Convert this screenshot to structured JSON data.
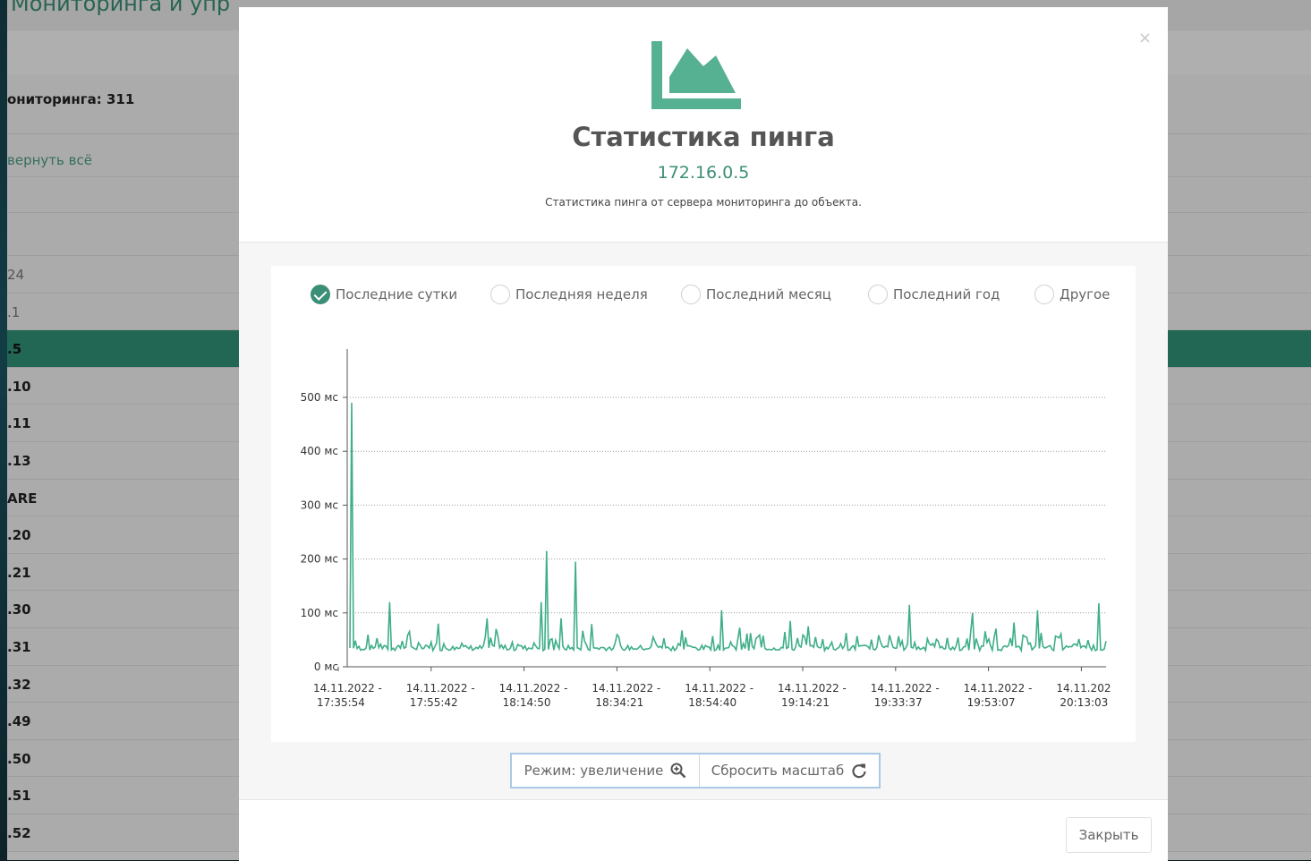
{
  "background": {
    "title": "Мониторинга и упр",
    "monitoring_count": "ониторинга: 311",
    "collapse_link": "вернуть всё",
    "rows": [
      "24",
      ".1",
      ".5",
      ".10",
      ".11",
      ".13",
      "ARE",
      ".20",
      ".21",
      ".30",
      ".31",
      ".32",
      ".49",
      ".50",
      ".51",
      ".52"
    ],
    "active_row_index": 2
  },
  "modal": {
    "icon": "area-chart-icon",
    "title": "Статистика пинга",
    "ip": "172.16.0.5",
    "description": "Статистика пинга от сервера мониторинга до объекта.",
    "close_symbol": "×",
    "periods": [
      {
        "label": "Последние сутки",
        "checked": true
      },
      {
        "label": "Последняя неделя",
        "checked": false
      },
      {
        "label": "Последний месяц",
        "checked": false
      },
      {
        "label": "Последний год",
        "checked": false
      },
      {
        "label": "Другое",
        "checked": false
      }
    ],
    "zoom_mode_label": "Режим: увеличение",
    "reset_zoom_label": "Сбросить масштаб",
    "footer_close_label": "Закрыть"
  },
  "colors": {
    "accent": "#3c8f77",
    "series": "#3fae8a",
    "active_row": "#2f8f73"
  },
  "chart_data": {
    "type": "line",
    "title": "",
    "xlabel": "",
    "ylabel": "",
    "ylim": [
      0,
      500
    ],
    "y_ticks": [
      "0 мс",
      "100 мс",
      "200 мс",
      "300 мс",
      "400 мс",
      "500 мс"
    ],
    "grid": true,
    "x_ticks": [
      [
        "14.11.2022 -",
        "17:35:54"
      ],
      [
        "14.11.2022 -",
        "17:55:42"
      ],
      [
        "14.11.2022 -",
        "18:14:50"
      ],
      [
        "14.11.2022 -",
        "18:34:21"
      ],
      [
        "14.11.2022 -",
        "18:54:40"
      ],
      [
        "14.11.2022 -",
        "19:14:21"
      ],
      [
        "14.11.2022 -",
        "19:33:37"
      ],
      [
        "14.11.2022 -",
        "19:53:07"
      ],
      [
        "14.11.202",
        "20:13:03"
      ]
    ],
    "series": [
      {
        "baseline_ms": 35,
        "points": 420,
        "spikes": [
          {
            "at": 0.003,
            "ms": 490
          },
          {
            "at": 0.052,
            "ms": 120
          },
          {
            "at": 0.117,
            "ms": 80
          },
          {
            "at": 0.181,
            "ms": 90
          },
          {
            "at": 0.252,
            "ms": 120
          },
          {
            "at": 0.259,
            "ms": 215
          },
          {
            "at": 0.28,
            "ms": 90
          },
          {
            "at": 0.299,
            "ms": 195
          },
          {
            "at": 0.492,
            "ms": 105
          },
          {
            "at": 0.582,
            "ms": 85
          },
          {
            "at": 0.741,
            "ms": 115
          },
          {
            "at": 0.824,
            "ms": 100
          },
          {
            "at": 0.909,
            "ms": 105
          },
          {
            "at": 0.991,
            "ms": 118
          }
        ]
      }
    ]
  }
}
